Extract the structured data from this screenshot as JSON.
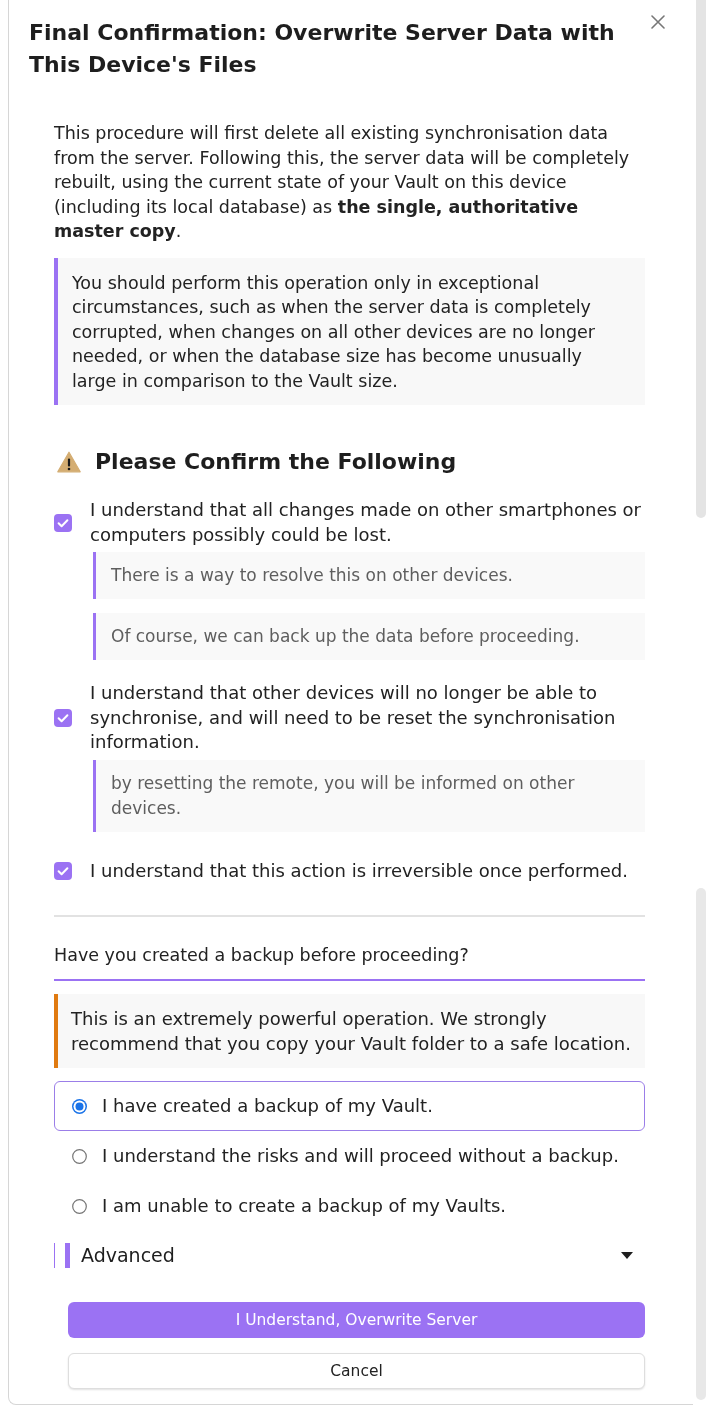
{
  "dialog": {
    "title": "Final Confirmation: Overwrite Server Data with This Device's Files"
  },
  "intro": "This procedure will first delete all existing synchronisation data from the server. Following this, the server data will be completely rebuilt, using the current state of your Vault on this device (including its local database) as **the single, authoritative master copy**.",
  "notice": "You should perform this operation only in exceptional circumstances, such as when the server data is completely corrupted, when changes on all other devices are no longer needed, or when the database size has become unusually large in comparison to the Vault size.",
  "confirmations": {
    "heading": "Please Confirm the Following",
    "items": [
      {
        "label": "I understand that all changes made on other smartphones or computers possibly could be lost.",
        "checked": true,
        "notes": [
          "There is a way to resolve this on other devices.",
          "Of course, we can back up the data before proceeding."
        ]
      },
      {
        "label": "I understand that other devices will no longer be able to synchronise, and will need to be reset the synchronisation information.",
        "checked": true,
        "notes": [
          "by resetting the remote, you will be informed on other devices."
        ]
      },
      {
        "label": "I understand that this action is irreversible once performed.",
        "checked": true
      }
    ]
  },
  "backup": {
    "question": "Have you created a backup before proceeding?",
    "warning": "This is an extremely powerful operation. We strongly recommend that you copy your Vault folder to a safe location.",
    "options": [
      {
        "label": "I have created a backup of my Vault.",
        "selected": true
      },
      {
        "label": "I understand the risks and will proceed without a backup.",
        "selected": false
      },
      {
        "label": "I am unable to create a backup of my Vaults.",
        "selected": false
      }
    ]
  },
  "advanced": {
    "label": "Advanced"
  },
  "buttons": [
    {
      "label": "I Understand, Overwrite Server",
      "kind": "primary"
    },
    {
      "label": "Cancel",
      "kind": "secondary"
    }
  ]
}
